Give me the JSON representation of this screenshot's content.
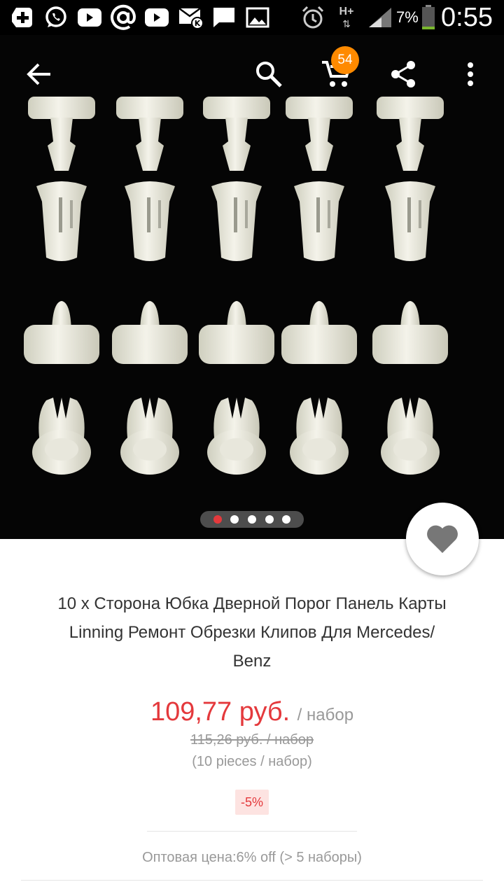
{
  "status_bar": {
    "battery_percent": "7%",
    "time": "0:55",
    "network": "H+",
    "icons": [
      "add-icon",
      "whatsapp-icon",
      "youtube-icon",
      "at-sign-icon",
      "youtube-icon",
      "mail-icon",
      "chat-icon",
      "image-icon",
      "alarm-icon",
      "signal-icon",
      "battery-icon"
    ]
  },
  "toolbar": {
    "cart_count": "54",
    "icons": [
      "back-arrow-icon",
      "search-icon",
      "cart-icon",
      "share-icon",
      "more-vert-icon"
    ]
  },
  "gallery": {
    "total_images": 5,
    "active_index": 0
  },
  "product": {
    "title_lines": [
      "10 x Сторона Юбка Дверной Порог Панель Карты",
      "Linning Ремонт Обрезки Клипов Для Mercedes/",
      "Benz"
    ],
    "price": "109,77 руб.",
    "unit": "/ набор",
    "old_price": "115,26 руб. / набор",
    "pieces": "(10 pieces / набор)",
    "discount": "-5%",
    "wholesale": "Оптовая цена:6% off (> 5 наборы)"
  },
  "colors": {
    "accent_red": "#e4393c",
    "badge_orange": "#ff8a00"
  }
}
